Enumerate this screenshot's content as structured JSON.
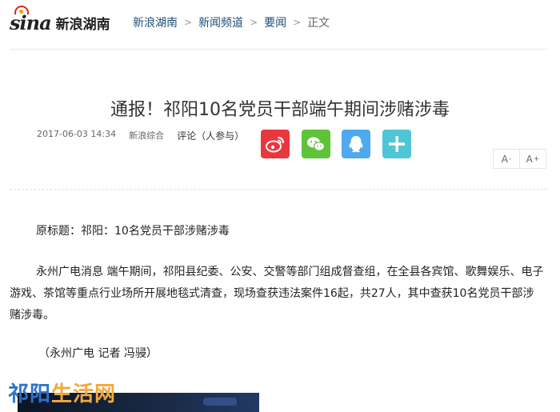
{
  "header": {
    "logo_text": "sina",
    "site_name": "新浪湖南",
    "breadcrumb": {
      "items": [
        "新浪湖南",
        "新闻频道",
        "要闻"
      ],
      "separator": ">",
      "current": "正文"
    }
  },
  "article": {
    "title": "通报！祁阳10名党员干部端午期间涉赌涉毒",
    "date": "2017-06-03 14:34",
    "source": "新浪综合",
    "comment_label": "评论（人参与）",
    "paragraphs": [
      "原标题：祁阳：10名党员干部涉赌涉毒",
      "永州广电消息 端午期间，祁阳县纪委、公安、交警等部门组成督查组，在全县各宾馆、歌舞娱乐、电子游戏、茶馆等重点行业场所开展地毯式清查，现场查获违法案件16起，共27人，其中查获10名党员干部涉赌涉毒。",
      "（永州广电 记者 冯骎）"
    ]
  },
  "share": {
    "icons": [
      "weibo-icon",
      "wechat-icon",
      "qq-icon",
      "plus-icon"
    ],
    "colors": {
      "weibo": "#e9373e",
      "wechat": "#5ec339",
      "qq": "#4fa9ef",
      "more": "#4fc6d8"
    }
  },
  "font_controls": {
    "decrease_label": "A",
    "decrease_mark": "-",
    "increase_label": "A",
    "increase_mark": "+"
  },
  "watermark": {
    "part1": "祁阳",
    "part2": "生活网"
  },
  "colors": {
    "link": "#1f4e79",
    "brand_red": "#e2231a"
  }
}
